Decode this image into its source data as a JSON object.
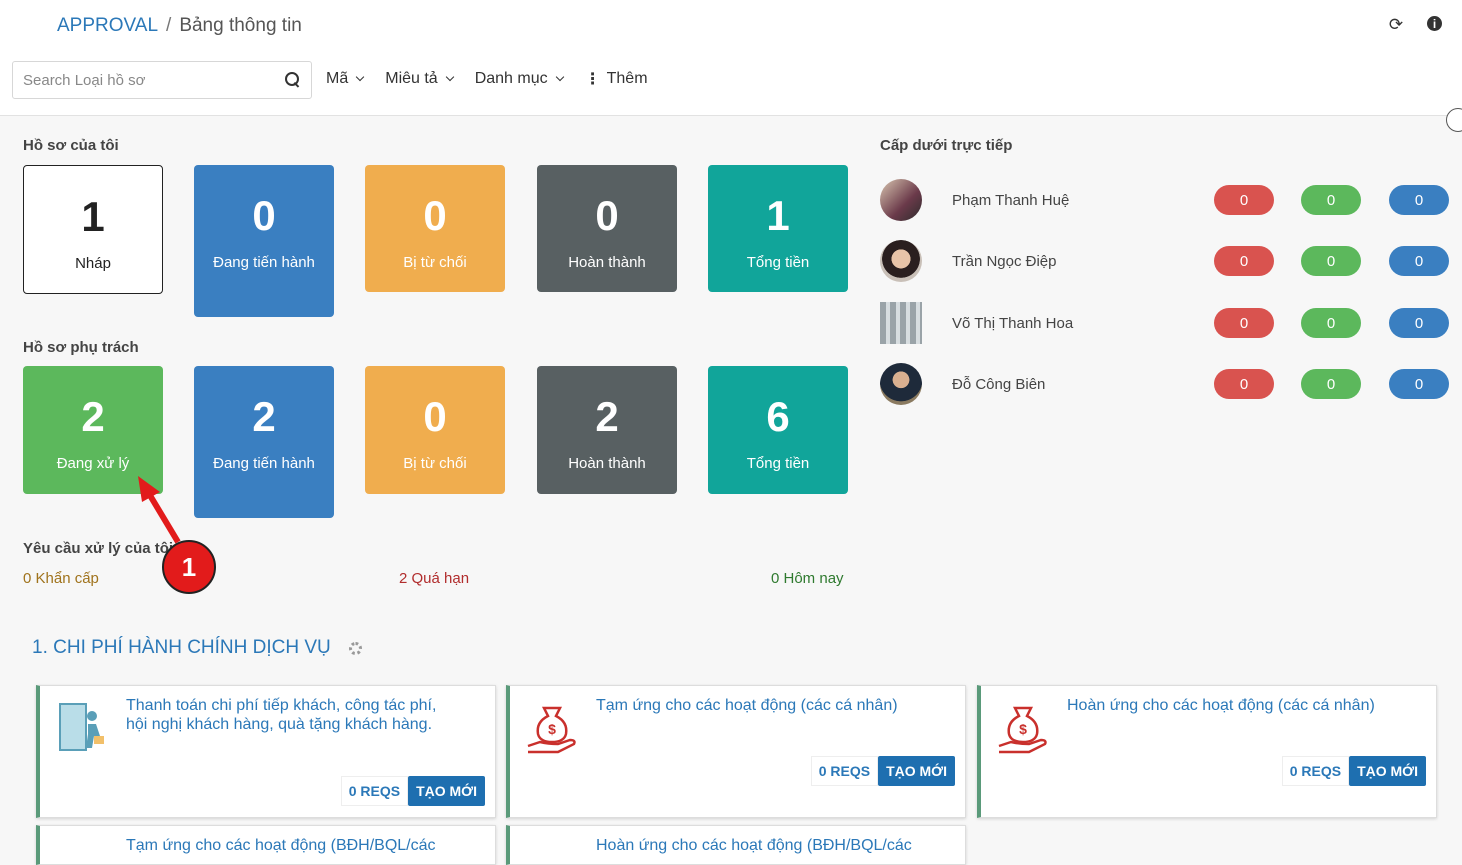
{
  "breadcrumb": {
    "app": "APPROVAL",
    "sep": "/",
    "current": "Bảng thông tin"
  },
  "search": {
    "placeholder": "Search Loại hồ sơ"
  },
  "filters": [
    {
      "label": "Mã"
    },
    {
      "label": "Miêu tả"
    },
    {
      "label": "Danh mục"
    },
    {
      "label": "Thêm"
    }
  ],
  "my_files": {
    "title": "Hồ sơ của tôi",
    "tiles": [
      {
        "num": "1",
        "label": "Nháp"
      },
      {
        "num": "0",
        "label": "Đang tiến hành"
      },
      {
        "num": "0",
        "label": "Bị từ chối"
      },
      {
        "num": "0",
        "label": "Hoàn thành"
      },
      {
        "num": "1",
        "label": "Tổng tiền"
      }
    ]
  },
  "assigned_files": {
    "title": "Hồ sơ phụ trách",
    "tiles": [
      {
        "num": "2",
        "label": "Đang xử lý"
      },
      {
        "num": "2",
        "label": "Đang tiến hành"
      },
      {
        "num": "0",
        "label": "Bị từ chối"
      },
      {
        "num": "2",
        "label": "Hoàn thành"
      },
      {
        "num": "6",
        "label": "Tổng tiền"
      }
    ]
  },
  "requests": {
    "title": "Yêu cầu xử lý của tôi",
    "urgent": "0 Khẩn cấp",
    "overdue": "2 Quá hạn",
    "today": "0 Hôm nay"
  },
  "subordinates": {
    "title": "Cấp dưới trực tiếp",
    "people": [
      {
        "name": "Phạm Thanh Huệ",
        "red": "0",
        "green": "0",
        "blue": "0"
      },
      {
        "name": "Trần Ngọc Điệp",
        "red": "0",
        "green": "0",
        "blue": "0"
      },
      {
        "name": "Võ Thị Thanh Hoa",
        "red": "0",
        "green": "0",
        "blue": "0"
      },
      {
        "name": "Đỗ Công Biên",
        "red": "0",
        "green": "0",
        "blue": "0"
      }
    ]
  },
  "category": {
    "title": "1. CHI PHÍ HÀNH CHÍNH DỊCH VỤ"
  },
  "cards": [
    {
      "title": "Thanh toán chi phí tiếp khách, công tác phí, hội nghị khách hàng, quà tặng khách hàng.",
      "reqs": "0 REQS",
      "new": "TẠO MỚI",
      "icon": "door-exit-icon"
    },
    {
      "title": "Tạm ứng cho các hoạt động (các cá nhân)",
      "reqs": "0 REQS",
      "new": "TẠO MỚI",
      "icon": "money-bag-icon"
    },
    {
      "title": "Hoàn ứng cho các hoạt động (các cá nhân)",
      "reqs": "0 REQS",
      "new": "TẠO MỚI",
      "icon": "money-bag-icon"
    },
    {
      "title": "Tạm ứng cho các hoạt động (BĐH/BQL/các",
      "reqs": "",
      "new": "",
      "icon": ""
    },
    {
      "title": "Hoàn ứng cho các hoạt động (BĐH/BQL/các",
      "reqs": "",
      "new": "",
      "icon": ""
    }
  ],
  "annotation": {
    "number": "1"
  },
  "colors": {
    "accent": "#2b78b8",
    "blue": "#3a7fc1",
    "orange": "#f0ad4e",
    "dark": "#586062",
    "teal": "#11a59a",
    "green": "#5cb85c",
    "red": "#d9534f"
  }
}
